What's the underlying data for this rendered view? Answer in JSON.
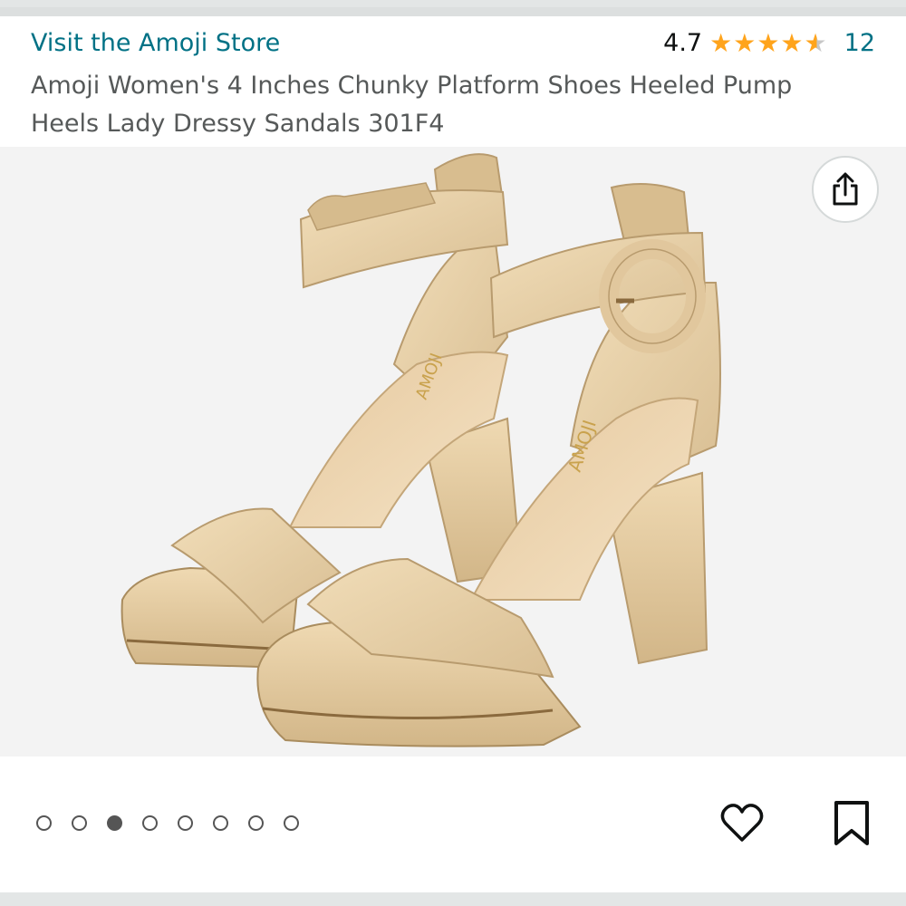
{
  "store": {
    "link_label": "Visit the Amoji Store"
  },
  "rating": {
    "value": "4.7",
    "stars": 4.7,
    "count": "12"
  },
  "product": {
    "title": "Amoji Women's 4 Inches Chunky Platform Shoes Heeled Pump Heels Lady Dressy Sandals 301F4",
    "image_brand_text": "AMOJI"
  },
  "carousel": {
    "total": 8,
    "active_index": 2
  },
  "icons": {
    "share": "share-icon",
    "wishlist": "heart-icon",
    "save": "bookmark-icon"
  },
  "colors": {
    "link": "#007185",
    "star": "#ffa41c",
    "text": "#565959"
  }
}
